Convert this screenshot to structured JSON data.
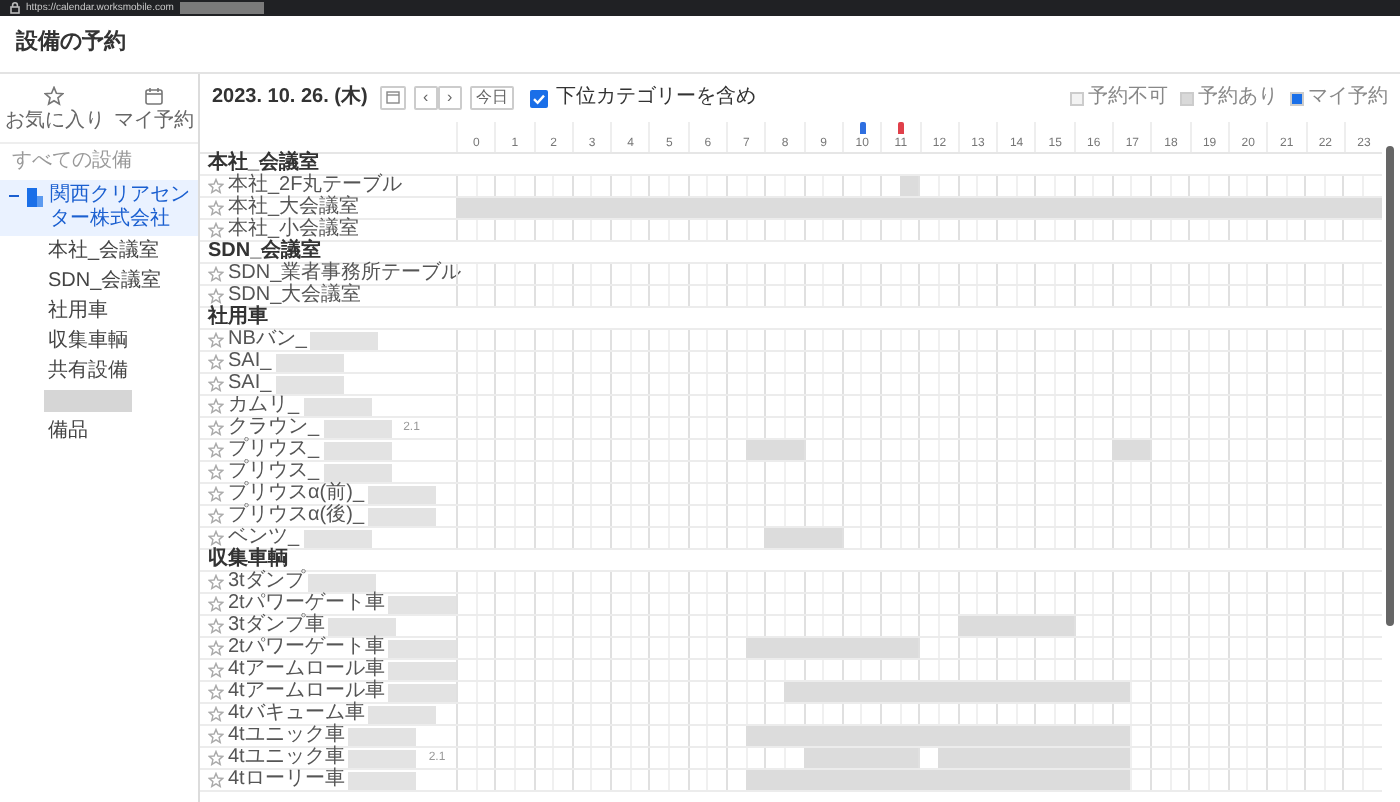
{
  "browser": {
    "url": "https://calendar.worksmobile.com",
    "url_redacted": true
  },
  "page_title": "設備の予約",
  "sidebar": {
    "shortcuts": [
      {
        "kind": "star",
        "label": "お気に入り"
      },
      {
        "kind": "calendar",
        "label": "マイ予約"
      }
    ],
    "section_label": "すべての設備",
    "tree": [
      {
        "label": "関西クリアセンター株式会社",
        "expanded": true,
        "selected": true,
        "children": [
          {
            "kind": "category",
            "label": "本社_会議室",
            "selected": false
          },
          {
            "kind": "category",
            "label": "SDN_会議室",
            "selected": false
          },
          {
            "kind": "category",
            "label": "社用車",
            "selected": false
          },
          {
            "kind": "category",
            "label": "収集車輌",
            "selected": false
          },
          {
            "kind": "category",
            "label": "共有設備",
            "selected": false
          },
          {
            "kind": "redacted",
            "selected": false
          },
          {
            "kind": "category",
            "label": "備品",
            "selected": false
          }
        ]
      }
    ]
  },
  "toolbar": {
    "date": "2023. 10. 26. (木)",
    "prev": "‹",
    "next": "›",
    "today_button": "今日",
    "include_subcategories": {
      "label": "下位カテゴリーを含め",
      "checked": true
    }
  },
  "legend": [
    {
      "label": "予約不可",
      "color": "#f3f3f3"
    },
    {
      "label": "予約あり",
      "color": "#d9d9d9"
    },
    {
      "label": "マイ予約",
      "color": "#1a6fe8"
    }
  ],
  "timeline": {
    "hours": [
      {
        "label": "0"
      },
      {
        "label": "1"
      },
      {
        "label": "2"
      },
      {
        "label": "3"
      },
      {
        "label": "4"
      },
      {
        "label": "5"
      },
      {
        "label": "6"
      },
      {
        "label": "7"
      },
      {
        "label": "8"
      },
      {
        "label": "9"
      },
      {
        "label": "10",
        "marker": {
          "color": "#2f6fe0"
        }
      },
      {
        "label": "11",
        "marker": {
          "color": "#e0404a"
        }
      },
      {
        "label": "12"
      },
      {
        "label": "13"
      },
      {
        "label": "14"
      },
      {
        "label": "15"
      },
      {
        "label": "16"
      },
      {
        "label": "17"
      },
      {
        "label": "18"
      },
      {
        "label": "19"
      },
      {
        "label": "20"
      },
      {
        "label": "21"
      },
      {
        "label": "22"
      },
      {
        "label": "23"
      }
    ],
    "groups": [
      {
        "title": "本社_会議室",
        "resources": [
          {
            "name": "本社_2F丸テーブル",
            "slots": [
              false,
              false,
              false,
              false,
              false,
              false,
              false,
              false,
              false,
              false,
              false,
              false,
              false,
              false,
              false,
              false,
              false,
              false,
              false,
              false,
              false,
              false,
              false,
              true,
              false,
              false,
              false,
              false,
              false,
              false,
              false,
              false,
              false,
              false,
              false,
              false,
              false,
              false,
              false,
              false,
              false,
              false,
              false,
              false,
              false,
              false,
              false,
              false
            ]
          },
          {
            "name": "本社_大会議室",
            "slots": [
              true,
              true,
              true,
              true,
              true,
              true,
              true,
              true,
              true,
              true,
              true,
              true,
              true,
              true,
              true,
              true,
              true,
              true,
              true,
              true,
              true,
              true,
              true,
              true,
              true,
              true,
              true,
              true,
              true,
              true,
              true,
              true,
              true,
              true,
              true,
              true,
              true,
              true,
              true,
              true,
              true,
              true,
              true,
              true,
              true,
              true,
              true,
              true
            ]
          },
          {
            "name": "本社_小会議室"
          }
        ]
      },
      {
        "title": "SDN_会議室",
        "resources": [
          {
            "name": "SDN_業者事務所テーブル"
          },
          {
            "name": "SDN_大会議室"
          }
        ]
      },
      {
        "title": "社用車",
        "resources": [
          {
            "name": "NBバン_",
            "redacted": true
          },
          {
            "name": "SAI_",
            "redacted": true
          },
          {
            "name": "SAI_",
            "redacted": true
          },
          {
            "name": "カムリ_",
            "redacted": true
          },
          {
            "name": "クラウン_",
            "redacted": true,
            "note": "2.1"
          },
          {
            "name": "プリウス_",
            "redacted": true,
            "slots": [
              false,
              false,
              false,
              false,
              false,
              false,
              false,
              false,
              false,
              false,
              false,
              false,
              false,
              false,
              false,
              true,
              true,
              true,
              false,
              false,
              false,
              false,
              false,
              false,
              false,
              false,
              false,
              false,
              false,
              false,
              false,
              false,
              false,
              false,
              true,
              true,
              false,
              false,
              false,
              false,
              false,
              false,
              false,
              false,
              false,
              false,
              false,
              false
            ]
          },
          {
            "name": "プリウス_",
            "redacted": true
          },
          {
            "name": "プリウスα(前)_",
            "redacted": true
          },
          {
            "name": "プリウスα(後)_",
            "redacted": true
          },
          {
            "name": "ベンツ_",
            "redacted": true,
            "slots": [
              false,
              false,
              false,
              false,
              false,
              false,
              false,
              false,
              false,
              false,
              false,
              false,
              false,
              false,
              false,
              false,
              true,
              true,
              true,
              true,
              false,
              false,
              false,
              false,
              false,
              false,
              false,
              false,
              false,
              false,
              false,
              false,
              false,
              false,
              false,
              false,
              false,
              false,
              false,
              false,
              false,
              false,
              false,
              false,
              false,
              false,
              false,
              false
            ]
          }
        ]
      },
      {
        "title": "収集車輌",
        "resources": [
          {
            "name": "3tダンプ",
            "redacted": true
          },
          {
            "name": "2tパワーゲート車",
            "redacted": true
          },
          {
            "name": "3tダンプ車",
            "redacted": true,
            "slots": [
              false,
              false,
              false,
              false,
              false,
              false,
              false,
              false,
              false,
              false,
              false,
              false,
              false,
              false,
              false,
              false,
              false,
              false,
              false,
              false,
              false,
              false,
              false,
              false,
              false,
              false,
              true,
              true,
              true,
              true,
              true,
              true,
              false,
              false,
              false,
              false,
              false,
              false,
              false,
              false,
              false,
              false,
              false,
              false,
              false,
              false,
              false,
              false
            ]
          },
          {
            "name": "2tパワーゲート車",
            "redacted": true,
            "slots": [
              false,
              false,
              false,
              false,
              false,
              false,
              false,
              false,
              false,
              false,
              false,
              false,
              false,
              false,
              false,
              true,
              true,
              true,
              true,
              true,
              true,
              true,
              true,
              true,
              false,
              false,
              false,
              false,
              false,
              false,
              false,
              false,
              false,
              false,
              false,
              false,
              false,
              false,
              false,
              false,
              false,
              false,
              false,
              false,
              false,
              false,
              false,
              false
            ]
          },
          {
            "name": "4tアームロール車",
            "redacted": true
          },
          {
            "name": "4tアームロール車",
            "redacted": true,
            "slots": [
              false,
              false,
              false,
              false,
              false,
              false,
              false,
              false,
              false,
              false,
              false,
              false,
              false,
              false,
              false,
              false,
              false,
              true,
              true,
              true,
              true,
              true,
              true,
              true,
              true,
              true,
              true,
              true,
              true,
              true,
              true,
              true,
              true,
              true,
              true,
              false,
              false,
              false,
              false,
              false,
              false,
              false,
              false,
              false,
              false,
              false,
              false,
              false
            ]
          },
          {
            "name": "4tバキューム車",
            "redacted": true
          },
          {
            "name": "4tユニック車",
            "redacted": true,
            "slots": [
              false,
              false,
              false,
              false,
              false,
              false,
              false,
              false,
              false,
              false,
              false,
              false,
              false,
              false,
              false,
              true,
              true,
              true,
              true,
              true,
              true,
              true,
              true,
              true,
              true,
              true,
              true,
              true,
              true,
              true,
              true,
              true,
              true,
              true,
              true,
              false,
              false,
              false,
              false,
              false,
              false,
              false,
              false,
              false,
              false,
              false,
              false,
              false
            ]
          },
          {
            "name": "4tユニック車",
            "redacted": true,
            "note": "2.1",
            "slots": [
              false,
              false,
              false,
              false,
              false,
              false,
              false,
              false,
              false,
              false,
              false,
              false,
              false,
              false,
              false,
              false,
              false,
              false,
              true,
              true,
              true,
              true,
              true,
              true,
              false,
              true,
              true,
              true,
              true,
              true,
              true,
              true,
              true,
              true,
              true,
              false,
              false,
              false,
              false,
              false,
              false,
              false,
              false,
              false,
              false,
              false,
              false,
              false
            ]
          },
          {
            "name": "4tローリー車",
            "redacted": true,
            "slots": [
              false,
              false,
              false,
              false,
              false,
              false,
              false,
              false,
              false,
              false,
              false,
              false,
              false,
              false,
              false,
              true,
              true,
              true,
              true,
              true,
              true,
              true,
              true,
              true,
              true,
              true,
              true,
              true,
              true,
              true,
              true,
              true,
              true,
              true,
              true,
              false,
              false,
              false,
              false,
              false,
              false,
              false,
              false,
              false,
              false,
              false,
              false,
              false
            ]
          }
        ]
      }
    ]
  }
}
